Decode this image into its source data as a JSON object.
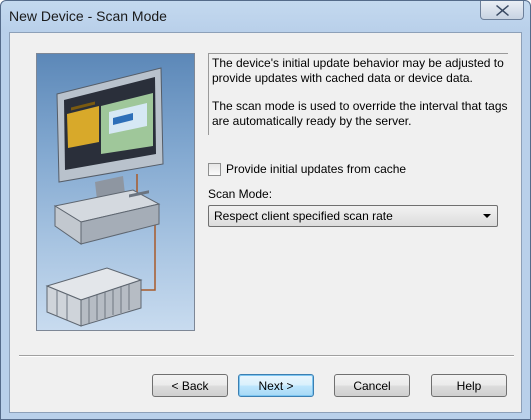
{
  "window": {
    "title": "New Device - Scan Mode"
  },
  "description": {
    "paragraph1": "The device's initial update behavior may be adjusted to provide updates with cached data or device data.",
    "paragraph2": "The scan mode is used to override the interval that tags are automatically ready by the server."
  },
  "options": {
    "initial_updates_label": "Provide initial updates from cache",
    "initial_updates_checked": false,
    "scan_mode_label": "Scan Mode:",
    "scan_mode_value": "Respect client specified scan rate"
  },
  "buttons": {
    "back": "< Back",
    "next": "Next >",
    "cancel": "Cancel",
    "help": "Help"
  },
  "icons": {
    "close": "close-icon",
    "dropdown": "chevron-down-icon",
    "illustration": "computer-and-device-illustration"
  }
}
